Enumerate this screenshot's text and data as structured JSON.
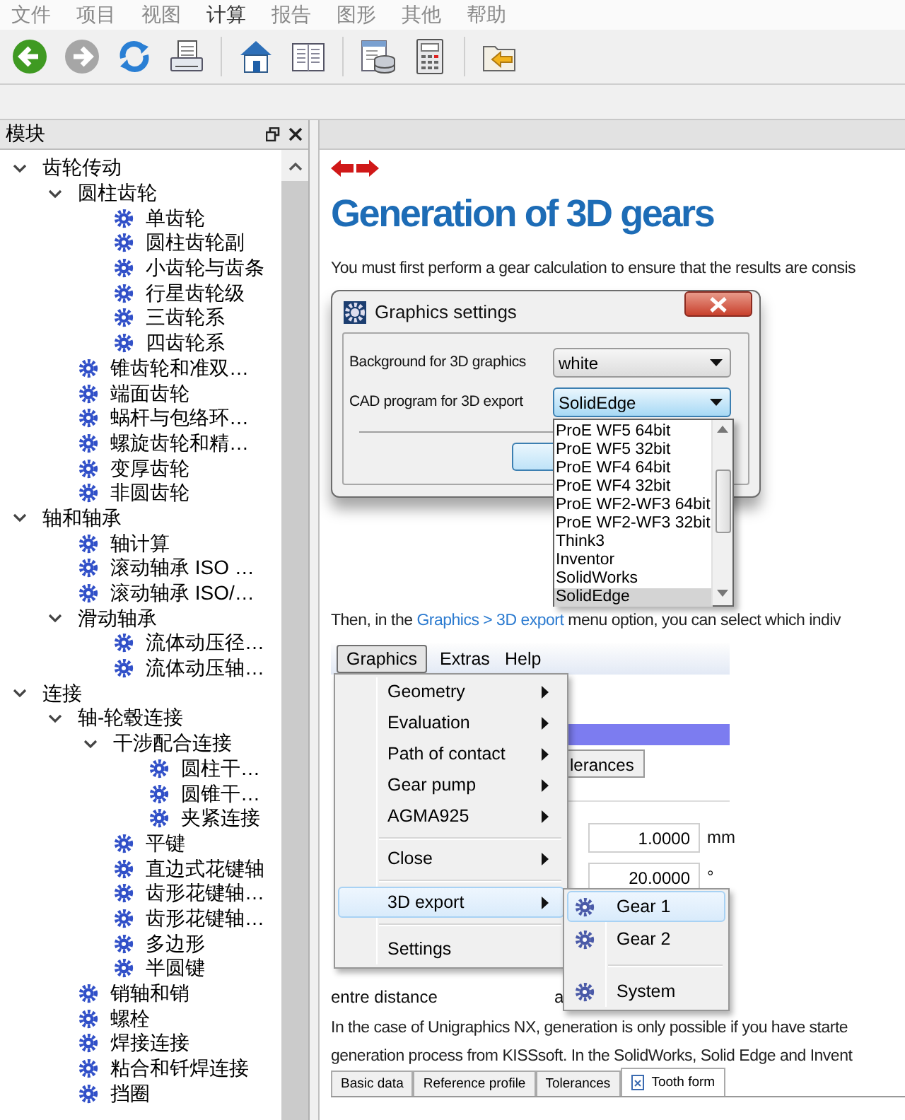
{
  "menu_bar": [
    {
      "label": "文件",
      "disabled": true
    },
    {
      "label": "项目",
      "disabled": true
    },
    {
      "label": "视图",
      "disabled": true
    },
    {
      "label": "计算",
      "disabled": false
    },
    {
      "label": "报告",
      "disabled": true
    },
    {
      "label": "图形",
      "disabled": true
    },
    {
      "label": "其他",
      "disabled": true
    },
    {
      "label": "帮助",
      "disabled": true
    }
  ],
  "toolbar": [
    {
      "kind": "back",
      "disabled": false
    },
    {
      "kind": "forward",
      "disabled": true
    },
    {
      "kind": "refresh",
      "disabled": false
    },
    {
      "kind": "print",
      "disabled": false
    },
    {
      "kind": "separator"
    },
    {
      "kind": "home",
      "disabled": false
    },
    {
      "kind": "book",
      "disabled": false
    },
    {
      "kind": "separator"
    },
    {
      "kind": "database",
      "disabled": false
    },
    {
      "kind": "calculator",
      "disabled": false
    },
    {
      "kind": "separator"
    },
    {
      "kind": "import",
      "disabled": false
    }
  ],
  "modules_panel": {
    "title": "模块",
    "tree": [
      {
        "label": "齿轮传动",
        "expanded": true,
        "children": [
          {
            "label": "圆柱齿轮",
            "expanded": true,
            "children": [
              {
                "label": "单齿轮"
              },
              {
                "label": "圆柱齿轮副"
              },
              {
                "label": "小齿轮与齿条"
              },
              {
                "label": "行星齿轮级"
              },
              {
                "label": "三齿轮系"
              },
              {
                "label": "四齿轮系"
              }
            ]
          },
          {
            "label": "锥齿轮和准双…"
          },
          {
            "label": "端面齿轮"
          },
          {
            "label": "蜗杆与包络环…"
          },
          {
            "label": "螺旋齿轮和精…"
          },
          {
            "label": "变厚齿轮"
          },
          {
            "label": "非圆齿轮"
          }
        ]
      },
      {
        "label": "轴和轴承",
        "expanded": true,
        "children": [
          {
            "label": "轴计算"
          },
          {
            "label": "滚动轴承 ISO …"
          },
          {
            "label": "滚动轴承 ISO/…"
          },
          {
            "label": "滑动轴承",
            "expanded": true,
            "children": [
              {
                "label": "流体动压径…"
              },
              {
                "label": "流体动压轴…"
              }
            ]
          }
        ]
      },
      {
        "label": "连接",
        "expanded": true,
        "children": [
          {
            "label": "轴-轮毂连接",
            "expanded": true,
            "children": [
              {
                "label": "干涉配合连接",
                "expanded": true,
                "children": [
                  {
                    "label": "圆柱干…"
                  },
                  {
                    "label": "圆锥干…"
                  },
                  {
                    "label": "夹紧连接"
                  }
                ]
              },
              {
                "label": "平键"
              },
              {
                "label": "直边式花键轴"
              },
              {
                "label": "齿形花键轴…"
              },
              {
                "label": "齿形花键轴…"
              },
              {
                "label": "多边形"
              },
              {
                "label": "半圆键"
              }
            ]
          },
          {
            "label": "销轴和销"
          },
          {
            "label": "螺栓"
          },
          {
            "label": "焊接连接"
          },
          {
            "label": "粘合和钎焊连接"
          },
          {
            "label": "挡圈"
          }
        ]
      }
    ]
  },
  "help_page": {
    "title": "Generation of 3D gears",
    "intro": "You must first perform a gear calculation to ensure that the results are consis",
    "dialog_screenshot": {
      "title": "Graphics settings",
      "fields": [
        {
          "label": "Background for 3D graphics",
          "value": "white",
          "focused": false
        },
        {
          "label": "CAD program for 3D export",
          "value": "SolidEdge",
          "focused": true
        }
      ],
      "options": [
        {
          "label": "ProE WF5 64bit",
          "selected": false
        },
        {
          "label": "ProE WF5 32bit",
          "selected": false
        },
        {
          "label": "ProE WF4 64bit",
          "selected": false
        },
        {
          "label": "ProE WF4 32bit",
          "selected": false
        },
        {
          "label": "ProE WF2-WF3 64bit",
          "selected": false
        },
        {
          "label": "ProE WF2-WF3 32bit",
          "selected": false
        },
        {
          "label": "Think3",
          "selected": false
        },
        {
          "label": "Inventor",
          "selected": false
        },
        {
          "label": "SolidWorks",
          "selected": false
        },
        {
          "label": "SolidEdge",
          "selected": true
        }
      ]
    },
    "menu_note": {
      "before": "Then, in the ",
      "link": "Graphics > 3D export",
      "after": " menu option, you can select which indiv"
    },
    "menu_screenshot": {
      "menu_bar": [
        {
          "label": "Graphics",
          "selected": true
        },
        {
          "label": "Extras",
          "selected": false
        },
        {
          "label": "Help",
          "selected": false
        }
      ],
      "menu": [
        {
          "kind": "item",
          "label": "Geometry",
          "submenu": true,
          "selected": false
        },
        {
          "kind": "item",
          "label": "Evaluation",
          "submenu": true,
          "selected": false
        },
        {
          "kind": "item",
          "label": "Path of contact",
          "submenu": true,
          "selected": false
        },
        {
          "kind": "item",
          "label": "Gear pump",
          "submenu": true,
          "selected": false
        },
        {
          "kind": "item",
          "label": "AGMA925",
          "submenu": true,
          "selected": false
        },
        {
          "kind": "separator"
        },
        {
          "kind": "item",
          "label": "Close",
          "submenu": true,
          "selected": false
        },
        {
          "kind": "separator"
        },
        {
          "kind": "item",
          "label": "3D export",
          "submenu": true,
          "selected": true
        },
        {
          "kind": "separator"
        },
        {
          "kind": "item",
          "label": "Settings",
          "submenu": false,
          "selected": false
        }
      ],
      "submenu": [
        {
          "kind": "item",
          "label": "Gear 1",
          "selected": true
        },
        {
          "kind": "item",
          "label": "Gear 2",
          "selected": false
        },
        {
          "kind": "separator"
        },
        {
          "kind": "item",
          "label": "System",
          "selected": false
        }
      ],
      "background": {
        "tab": "lerances",
        "fields": [
          {
            "value": "1.0000",
            "unit": "mm"
          },
          {
            "value": "20.0000",
            "unit": "°"
          }
        ],
        "label": "entre distance",
        "symbol": "a"
      }
    },
    "note_lines": [
      "In the case of Unigraphics NX, generation is only possible if you have starte",
      "generation process from KISSsoft. In the SolidWorks, Solid Edge and Invent"
    ],
    "tabs_screenshot": [
      {
        "label": "Basic data",
        "selected": false
      },
      {
        "label": "Reference profile",
        "selected": false
      },
      {
        "label": "Tolerances",
        "selected": false
      },
      {
        "label": "Tooth form",
        "selected": true
      }
    ]
  }
}
